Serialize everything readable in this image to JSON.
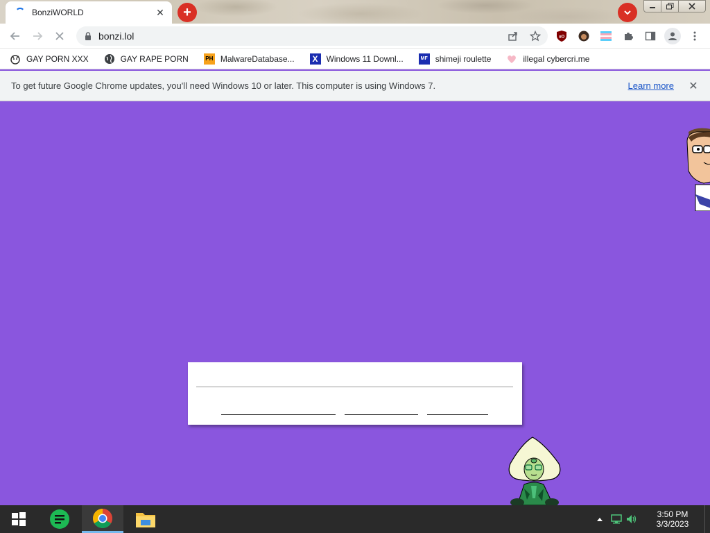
{
  "browser": {
    "tab_title": "BonziWORLD",
    "tab_close": "✕",
    "new_tab": "+",
    "url": "bonzi.lol",
    "accent_color": "#d93025"
  },
  "bookmarks": [
    {
      "label": "GAY PORN XXX",
      "icon": "bonzi-icon"
    },
    {
      "label": "GAY RAPE PORN",
      "icon": "globe-icon"
    },
    {
      "label": "MalwareDatabase...",
      "icon": "ph-icon",
      "icon_text": "PH"
    },
    {
      "label": "Windows 11 Downl...",
      "icon": "x-logo-icon",
      "icon_text": "X"
    },
    {
      "label": "shimeji roulette",
      "icon": "mf-icon",
      "icon_text": "MF"
    },
    {
      "label": "illegal cybercri.me",
      "icon": "heart-icon"
    }
  ],
  "infobar": {
    "message": "To get future Google Chrome updates, you'll need Windows 10 or later. This computer is using Windows 7.",
    "link": "Learn more",
    "close": "✕"
  },
  "page": {
    "background": "#8a56de"
  },
  "taskbar": {
    "time": "3:50 PM",
    "date": "3/3/2023"
  }
}
